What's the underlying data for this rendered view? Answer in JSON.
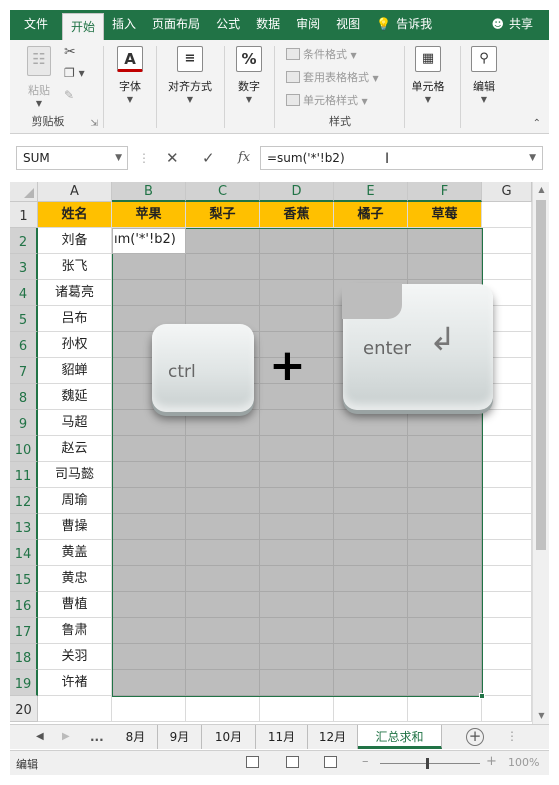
{
  "ribbon_tabs": [
    "文件",
    "开始",
    "插入",
    "页面布局",
    "公式",
    "数据",
    "审阅",
    "视图",
    "告诉我",
    "共享"
  ],
  "ribbon": {
    "clipboard": {
      "paste": "粘贴",
      "label": "剪贴板"
    },
    "font": {
      "button": "字体"
    },
    "alignment": {
      "button": "对齐方式"
    },
    "number": {
      "button": "数字"
    },
    "styles": {
      "conditional": "条件格式",
      "table": "套用表格格式",
      "cell": "单元格样式",
      "label": "样式"
    },
    "cells": {
      "button": "单元格"
    },
    "editing": {
      "button": "编辑"
    }
  },
  "formula_bar": {
    "name_box": "SUM",
    "fx": "fx",
    "formula": "=sum('*'!b2)"
  },
  "grid": {
    "columns": [
      "A",
      "B",
      "C",
      "D",
      "E",
      "F",
      "G"
    ],
    "rows": [
      "1",
      "2",
      "3",
      "4",
      "5",
      "6",
      "7",
      "8",
      "9",
      "10",
      "11",
      "12",
      "13",
      "14",
      "15",
      "16",
      "17",
      "18",
      "19",
      "20"
    ],
    "header_row": [
      "姓名",
      "苹果",
      "梨子",
      "香蕉",
      "橘子",
      "草莓"
    ],
    "names": [
      "刘备",
      "张飞",
      "诸葛亮",
      "吕布",
      "孙权",
      "貂蝉",
      "魏延",
      "马超",
      "赵云",
      "司马懿",
      "周瑜",
      "曹操",
      "黄盖",
      "黄忠",
      "曹植",
      "鲁肃",
      "关羽",
      "许褚"
    ],
    "editing_cell_text": "ım('*'!b2)"
  },
  "keys": {
    "ctrl": "ctrl",
    "plus": "+",
    "enter": "enter"
  },
  "sheet_tabs": [
    "8月",
    "9月",
    "10月",
    "11月",
    "12月",
    "汇总求和"
  ],
  "sheet_nav_more": "...",
  "active_sheet": "汇总求和",
  "status": {
    "mode": "编辑",
    "zoom": "100%"
  },
  "colors": {
    "accent": "#217346",
    "header_fill": "#ffc000",
    "selection_grey": "#bdbdbd"
  }
}
